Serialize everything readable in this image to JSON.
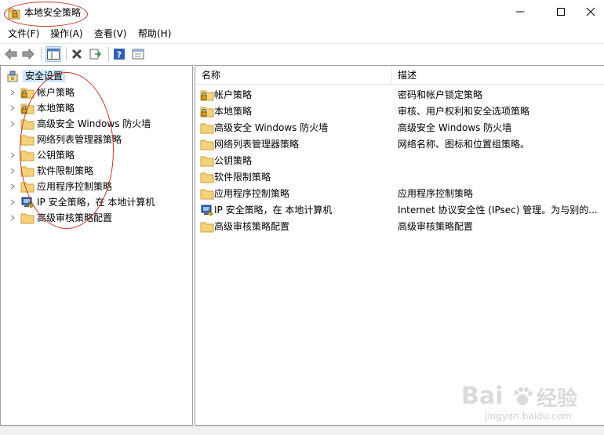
{
  "window": {
    "title": "本地安全策略"
  },
  "menu": [
    "文件(F)",
    "操作(A)",
    "查看(V)",
    "帮助(H)"
  ],
  "toolbar": {
    "back": "arrow-left-icon",
    "forward": "arrow-right-icon",
    "show_tree": "console-tree-icon",
    "delete": "delete-x-icon",
    "export": "export-list-icon",
    "help": "help-icon",
    "properties": "properties-icon"
  },
  "tree": {
    "root": "安全设置",
    "items": [
      {
        "label": "帐户策略",
        "icon": "lock-folder"
      },
      {
        "label": "本地策略",
        "icon": "lock-folder"
      },
      {
        "label": "高级安全 Windows 防火墙",
        "icon": "folder"
      },
      {
        "label": "网络列表管理器策略",
        "icon": "folder"
      },
      {
        "label": "公钥策略",
        "icon": "folder"
      },
      {
        "label": "软件限制策略",
        "icon": "folder"
      },
      {
        "label": "应用程序控制策略",
        "icon": "folder"
      },
      {
        "label": "IP 安全策略，在 本地计算机",
        "icon": "ipsec"
      },
      {
        "label": "高级审核策略配置",
        "icon": "folder"
      }
    ]
  },
  "list": {
    "columns": [
      "名称",
      "描述"
    ],
    "rows": [
      {
        "name": "帐户策略",
        "desc": "密码和帐户锁定策略",
        "icon": "lock-folder"
      },
      {
        "name": "本地策略",
        "desc": "审核、用户权利和安全选项策略",
        "icon": "lock-folder"
      },
      {
        "name": "高级安全 Windows 防火墙",
        "desc": "高级安全 Windows 防火墙",
        "icon": "folder"
      },
      {
        "name": "网络列表管理器策略",
        "desc": "网络名称、图标和位置组策略。",
        "icon": "folder"
      },
      {
        "name": "公钥策略",
        "desc": "",
        "icon": "folder"
      },
      {
        "name": "软件限制策略",
        "desc": "",
        "icon": "folder"
      },
      {
        "name": "应用程序控制策略",
        "desc": "应用程序控制策略",
        "icon": "folder"
      },
      {
        "name": "IP 安全策略，在 本地计算机",
        "desc": "Internet 协议安全性 (IPsec) 管理。为与别的...",
        "icon": "ipsec"
      },
      {
        "name": "高级审核策略配置",
        "desc": "高级审核策略配置",
        "icon": "folder"
      }
    ]
  },
  "watermark": {
    "logo": "Bai",
    "logo2": "经验",
    "url": "jingyan.baidu.com"
  },
  "colors": {
    "selection": "#cce8ff",
    "annotation": "#c0392b",
    "folder": "#f5d27a"
  }
}
